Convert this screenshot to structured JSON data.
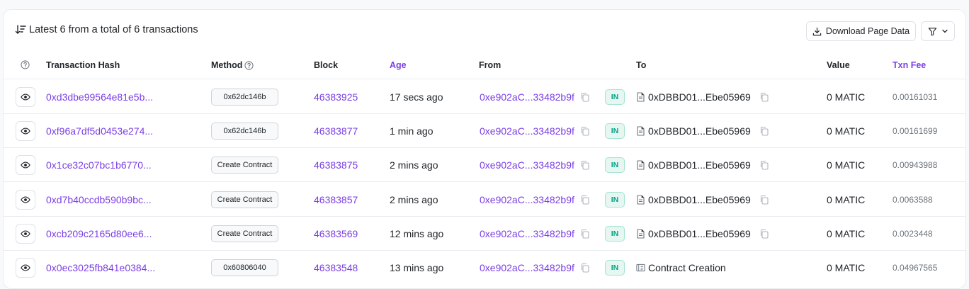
{
  "header": {
    "summary": "Latest 6 from a total of 6 transactions",
    "download_label": "Download Page Data"
  },
  "columns": {
    "hash": "Transaction Hash",
    "method": "Method",
    "block": "Block",
    "age": "Age",
    "from": "From",
    "to": "To",
    "value": "Value",
    "fee": "Txn Fee"
  },
  "rows": [
    {
      "hash": "0xd3dbe99564e81e5b...",
      "method": "0x62dc146b",
      "block": "46383925",
      "age": "17 secs ago",
      "from": "0xe902aC...33482b9f",
      "direction": "IN",
      "to": "0xDBBD01...Ebe05969",
      "to_type": "contract-file-icon",
      "value": "0 MATIC",
      "fee": "0.00161031"
    },
    {
      "hash": "0xf96a7df5d0453e274...",
      "method": "0x62dc146b",
      "block": "46383877",
      "age": "1 min ago",
      "from": "0xe902aC...33482b9f",
      "direction": "IN",
      "to": "0xDBBD01...Ebe05969",
      "to_type": "contract-file-icon",
      "value": "0 MATIC",
      "fee": "0.00161699"
    },
    {
      "hash": "0x1ce32c07bc1b6770...",
      "method": "Create Contract",
      "block": "46383875",
      "age": "2 mins ago",
      "from": "0xe902aC...33482b9f",
      "direction": "IN",
      "to": "0xDBBD01...Ebe05969",
      "to_type": "contract-file-icon",
      "value": "0 MATIC",
      "fee": "0.00943988"
    },
    {
      "hash": "0xd7b40ccdb590b9bc...",
      "method": "Create Contract",
      "block": "46383857",
      "age": "2 mins ago",
      "from": "0xe902aC...33482b9f",
      "direction": "IN",
      "to": "0xDBBD01...Ebe05969",
      "to_type": "contract-file-icon",
      "value": "0 MATIC",
      "fee": "0.0063588"
    },
    {
      "hash": "0xcb209c2165d80ee6...",
      "method": "Create Contract",
      "block": "46383569",
      "age": "12 mins ago",
      "from": "0xe902aC...33482b9f",
      "direction": "IN",
      "to": "0xDBBD01...Ebe05969",
      "to_type": "contract-file-icon",
      "value": "0 MATIC",
      "fee": "0.0023448"
    },
    {
      "hash": "0x0ec3025fb841e0384...",
      "method": "0x60806040",
      "block": "46383548",
      "age": "13 mins ago",
      "from": "0xe902aC...33482b9f",
      "direction": "IN",
      "to": "Contract Creation",
      "to_type": "contract-creation-icon",
      "value": "0 MATIC",
      "fee": "0.04967565"
    }
  ],
  "colors": {
    "link": "#7b3fe4",
    "in_badge_text": "#00a186",
    "in_badge_bg": "#e6f7f2"
  }
}
